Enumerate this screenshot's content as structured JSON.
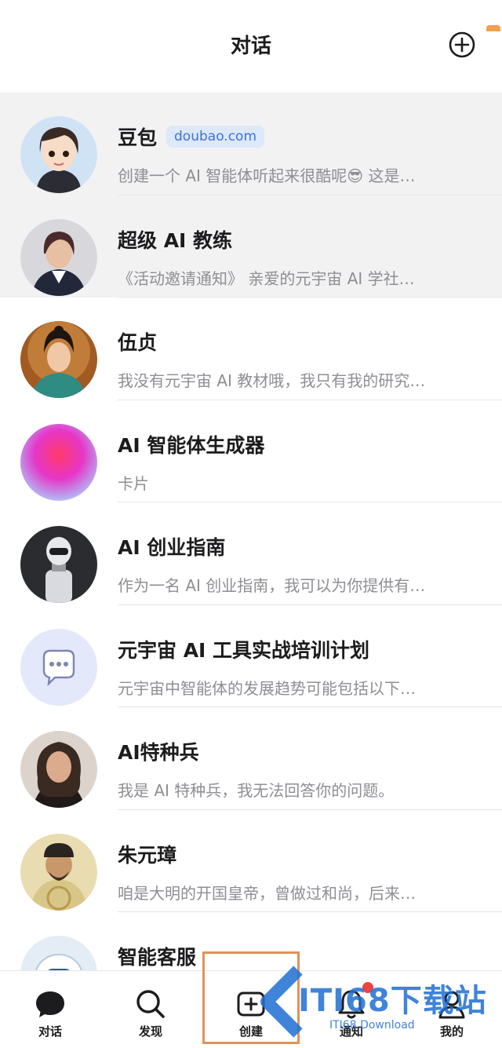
{
  "header": {
    "title": "对话",
    "add_icon": "plus-circle-icon"
  },
  "chats": [
    {
      "name": "豆包",
      "badge": "doubao.com",
      "preview": "创建一个 AI 智能体听起来很酷呢😎 这是…",
      "pinned": true
    },
    {
      "name": "超级 AI 教练",
      "preview": "《活动邀请通知》 亲爱的元宇宙 AI 学社…",
      "pinned": true
    },
    {
      "name": "伍贞",
      "preview": "我没有元宇宙 AI 教材哦，我只有我的研究…"
    },
    {
      "name": "AI 智能体生成器",
      "preview": "卡片"
    },
    {
      "name": "AI 创业指南",
      "preview": "作为一名 AI 创业指南，我可以为你提供有…"
    },
    {
      "name": "元宇宙 AI 工具实战培训计划",
      "preview": "元宇宙中智能体的发展趋势可能包括以下…"
    },
    {
      "name": "AI特种兵",
      "preview": "我是 AI 特种兵，我无法回答你的问题。"
    },
    {
      "name": "朱元璋",
      "preview": "咱是大明的开国皇帝，曾做过和尚，后来…"
    },
    {
      "name": "智能客服",
      "preview": ""
    }
  ],
  "tabbar": {
    "tabs": [
      {
        "label": "对话",
        "icon": "chat-bubble-icon"
      },
      {
        "label": "发现",
        "icon": "search-icon"
      },
      {
        "label": "创建",
        "icon": "create-icon"
      },
      {
        "label": "通知",
        "icon": "bell-icon"
      },
      {
        "label": "我的",
        "icon": "user-icon"
      }
    ]
  },
  "watermark": {
    "text": "ITI68下载站",
    "sub": "ITI68 Download"
  },
  "colors": {
    "accent_blue": "#3a74d8",
    "badge_bg": "#dde8f8",
    "pinned_bg": "#f2f2f3",
    "highlight_orange": "#e0925a"
  }
}
